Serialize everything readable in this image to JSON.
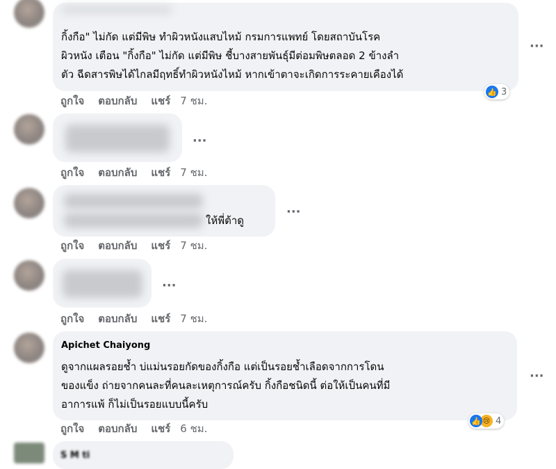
{
  "comments": [
    {
      "text_lines": [
        "กิ้งกือ\" ไม่กัด แต่มีพิษ ทำผิวหนังแสบไหม้ กรมการแพทย์ โดยสถาบันโรค",
        "ผิวหนัง เตือน \"กิ้งกือ\" ไม่กัด แต่มีพิษ ชี้บางสายพันธุ์มีต่อมพิษตลอด 2 ข้างลำ",
        "ตัว ฉีดสารพิษได้ไกลมีฤทธิ์ทำผิวหนังไหม้ หากเข้าตาจะเกิดการระคายเคืองได้"
      ],
      "reaction_count": "3",
      "actions": {
        "like": "ถูกใจ",
        "reply": "ตอบกลับ",
        "share": "แชร์",
        "time": "7 ชม."
      }
    },
    {
      "actions": {
        "like": "ถูกใจ",
        "reply": "ตอบกลับ",
        "share": "แชร์",
        "time": "7 ชม."
      }
    },
    {
      "visible_text": "ให้พี่ต้าดู",
      "actions": {
        "like": "ถูกใจ",
        "reply": "ตอบกลับ",
        "share": "แชร์",
        "time": "7 ชม."
      }
    },
    {
      "actions": {
        "like": "ถูกใจ",
        "reply": "ตอบกลับ",
        "share": "แชร์",
        "time": "7 ชม."
      }
    },
    {
      "author": "Apichet Chaiyong",
      "text_lines": [
        "ดูจากแผลรอยช้ำ บ่แม่นรอยกัดของกิ้งกือ แต่เป็นรอยช้ำเลือดจากการโดน",
        "ของแข็ง ถ่ายจากคนละที่คนละเหตุการณ์ครับ กิ้งกือชนิดนี้ ต่อให้เป็นคนที่มี",
        "อาการแพ้ ก็ไม่เป็นรอยแบบนี้ครับ"
      ],
      "reaction_count": "4",
      "actions": {
        "like": "ถูกใจ",
        "reply": "ตอบกลับ",
        "share": "แชร์",
        "time": "6 ชม."
      }
    }
  ],
  "more_label": "···",
  "last_author_partial": "S      M       ti"
}
